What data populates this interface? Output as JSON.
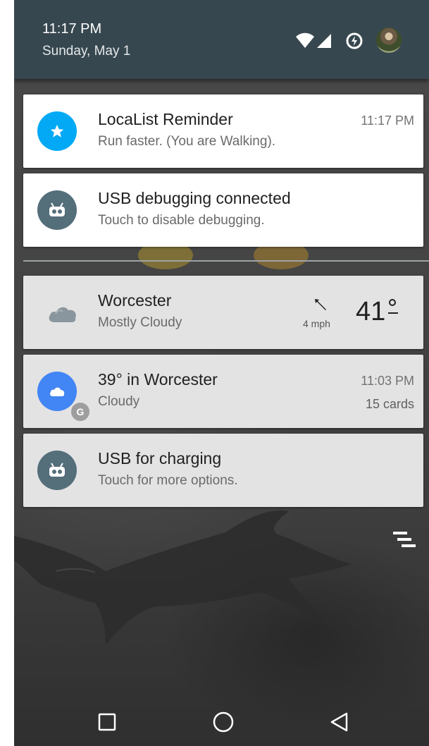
{
  "status_bar": {
    "time": "11:17 PM",
    "date": "Sunday, May 1",
    "icons": [
      "wifi-icon",
      "cell-signal-icon",
      "data-saver-icon",
      "user-avatar-icon"
    ]
  },
  "notifications": [
    {
      "app": "LocaList",
      "title": "LocaList Reminder",
      "text": "Run faster. (You are Walking).",
      "time": "11:17 PM",
      "icon": "star-icon",
      "icon_color": "#03a9f4"
    },
    {
      "title": "USB debugging connected",
      "text": "Touch to disable debugging.",
      "icon": "android-debug-icon",
      "icon_color": "#546e7a"
    }
  ],
  "secondary_notifications": [
    {
      "title": "Worcester",
      "text": "Mostly Cloudy",
      "wind": "4 mph",
      "temperature": "41",
      "icon": "cloud-icon"
    },
    {
      "title": "39° in Worcester",
      "text": "Cloudy",
      "time": "11:03 PM",
      "count": "15 cards",
      "icon": "google-cloud-icon",
      "icon_color": "#4285f4",
      "badge": "G"
    },
    {
      "title": "USB for charging",
      "text": "Touch for more options.",
      "icon": "android-debug-icon",
      "icon_color": "#546e7a"
    }
  ],
  "actions": {
    "dismiss_all_icon": "clear-all-icon"
  },
  "navigation_bar": {
    "buttons": [
      "recents-icon",
      "home-icon",
      "back-icon"
    ]
  },
  "colors": {
    "shade": "#37474f",
    "card_white": "#ffffff",
    "card_grey": "#e3e3e3",
    "accent_blue": "#03a9f4",
    "google_blue": "#4285f4",
    "debug_grey": "#546e7a"
  }
}
